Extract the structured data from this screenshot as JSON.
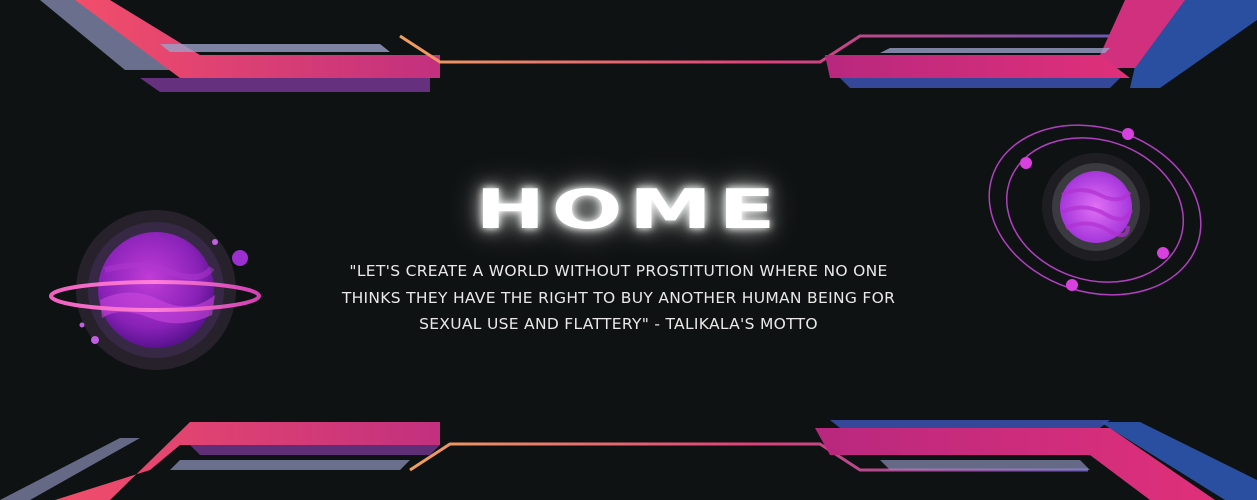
{
  "page": {
    "title": "HOME",
    "motto_lines": [
      "\"LET'S CREATE A WORLD WITHOUT PROSTITUTION WHERE NO ONE",
      "THINKS THEY HAVE THE RIGHT TO BUY ANOTHER HUMAN BEING FOR",
      "SEXUAL USE AND FLATTERY\" - TALIKALA'S MOTTO"
    ]
  },
  "colors": {
    "background": "#0f1212",
    "accent_pink": "#f0506e",
    "accent_magenta": "#d8308a",
    "accent_blue": "#2a4fa0",
    "accent_orange": "#f0a060",
    "planet_purple": "#9b2fd0",
    "planet_pink": "#e040f0"
  },
  "decorations": [
    "left-planet-with-ring",
    "right-orbit-planet",
    "top-frame-stripes",
    "bottom-frame-stripes"
  ]
}
